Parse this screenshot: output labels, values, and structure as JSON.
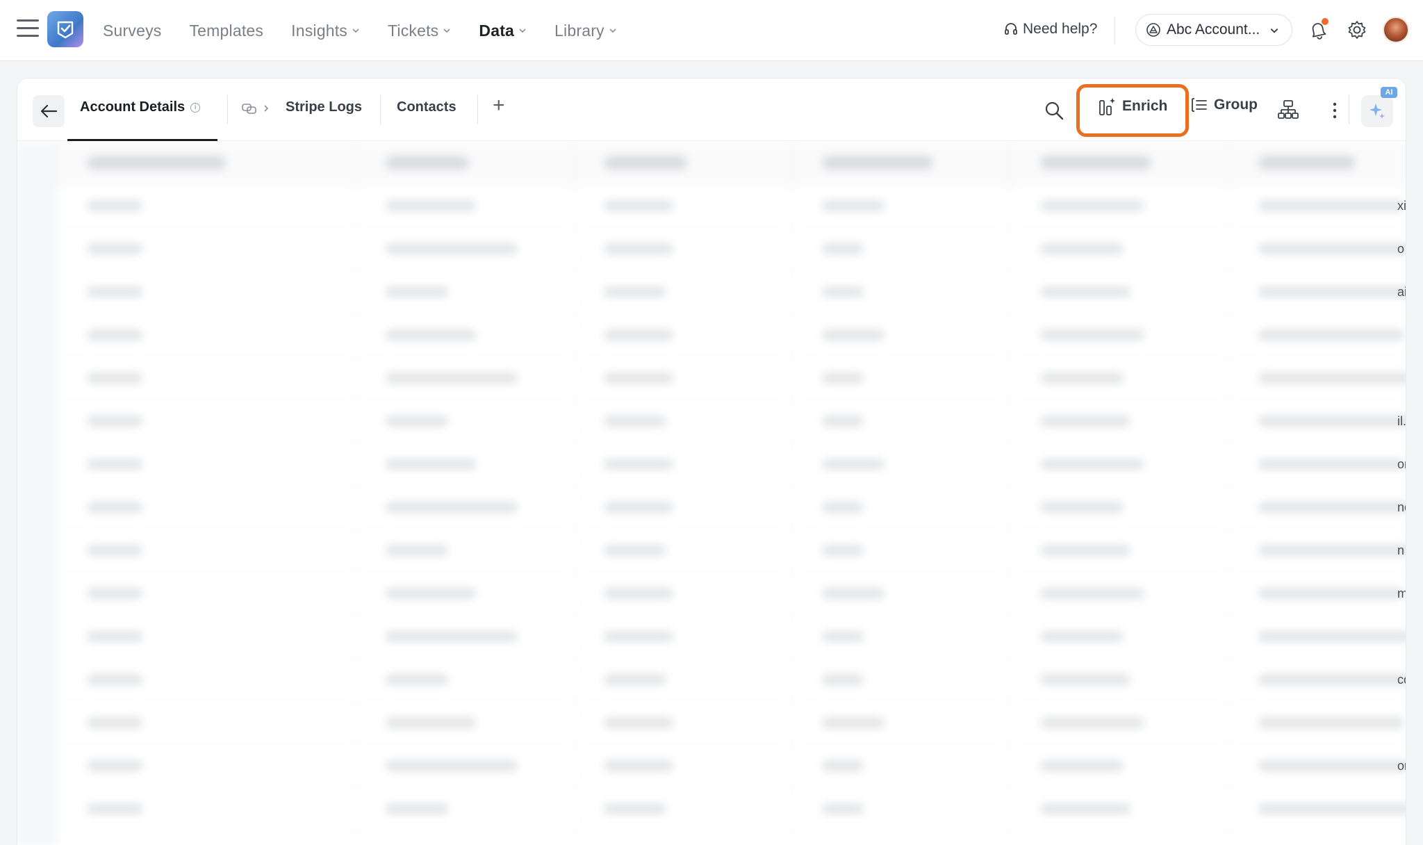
{
  "nav": {
    "items": [
      {
        "label": "Surveys",
        "has_chevron": false,
        "active": false
      },
      {
        "label": "Templates",
        "has_chevron": false,
        "active": false
      },
      {
        "label": "Insights",
        "has_chevron": true,
        "active": false
      },
      {
        "label": "Tickets",
        "has_chevron": true,
        "active": false
      },
      {
        "label": "Data",
        "has_chevron": true,
        "active": true
      },
      {
        "label": "Library",
        "has_chevron": true,
        "active": false
      }
    ]
  },
  "header": {
    "help_label": "Need help?",
    "account_label": "Abc Account...",
    "notification_dot_color": "#f06a2a"
  },
  "tabs": {
    "account_details": "Account Details",
    "info_glyph": "i",
    "stripe_logs": "Stripe Logs",
    "contacts": "Contacts",
    "add": "+"
  },
  "tools": {
    "enrich": "Enrich",
    "group": "Group",
    "ai_badge": "AI"
  },
  "colors": {
    "highlight": "#e8701f",
    "ai_badge": "#6ba7e6"
  },
  "grid": {
    "edge_fragments": [
      "xi",
      "o",
      "ail",
      "",
      "",
      "il.",
      "or",
      "nc",
      "n",
      "m",
      "",
      "co",
      "",
      "or",
      ""
    ]
  }
}
